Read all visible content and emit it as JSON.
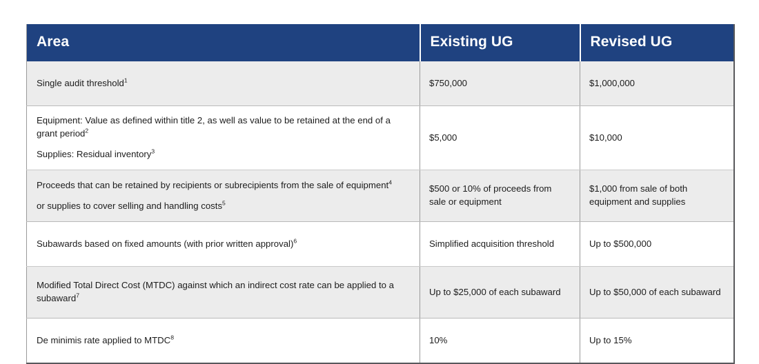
{
  "table": {
    "headers": {
      "area": "Area",
      "existing": "Existing UG",
      "revised": "Revised UG"
    },
    "colors": {
      "header_background": "#1f4280",
      "header_text": "#ffffff",
      "row_shaded_background": "#ececec",
      "row_plain_background": "#ffffff",
      "body_text": "#1c1c1c",
      "inner_border": "#b9b9b9",
      "outer_border": "#58585b"
    },
    "rows": [
      {
        "area_lines": [
          "Single audit threshold"
        ],
        "area_footnotes": [
          "1"
        ],
        "existing": "$750,000",
        "revised": "$1,000,000",
        "shaded": true
      },
      {
        "area_lines": [
          "Equipment: Value as defined within title 2, as well as value to be retained at the end of a grant period",
          "Supplies: Residual inventory"
        ],
        "area_footnotes": [
          "2",
          "3"
        ],
        "existing": "$5,000",
        "revised": "$10,000",
        "shaded": false
      },
      {
        "area_lines": [
          "Proceeds that can be retained by recipients or subrecipients from the sale of equipment",
          "or supplies to cover selling and handling costs"
        ],
        "area_footnotes": [
          "4",
          "5"
        ],
        "existing": "$500 or 10% of proceeds from sale or equipment",
        "revised": "$1,000 from sale of both equipment and supplies",
        "shaded": true
      },
      {
        "area_lines": [
          "Subawards based on fixed amounts (with prior written approval)"
        ],
        "area_footnotes": [
          "6"
        ],
        "existing": "Simplified acquisition threshold",
        "revised": "Up to $500,000",
        "shaded": false
      },
      {
        "area_lines": [
          "Modified Total Direct Cost (MTDC) against which an indirect cost rate can be applied to a subaward"
        ],
        "area_footnotes": [
          "7"
        ],
        "existing": "Up to $25,000 of each subaward",
        "revised": "Up to $50,000 of each subaward",
        "shaded": true
      },
      {
        "area_lines": [
          "De minimis rate applied to MTDC"
        ],
        "area_footnotes": [
          "8"
        ],
        "existing": "10%",
        "revised": "Up to 15%",
        "shaded": false
      }
    ]
  }
}
